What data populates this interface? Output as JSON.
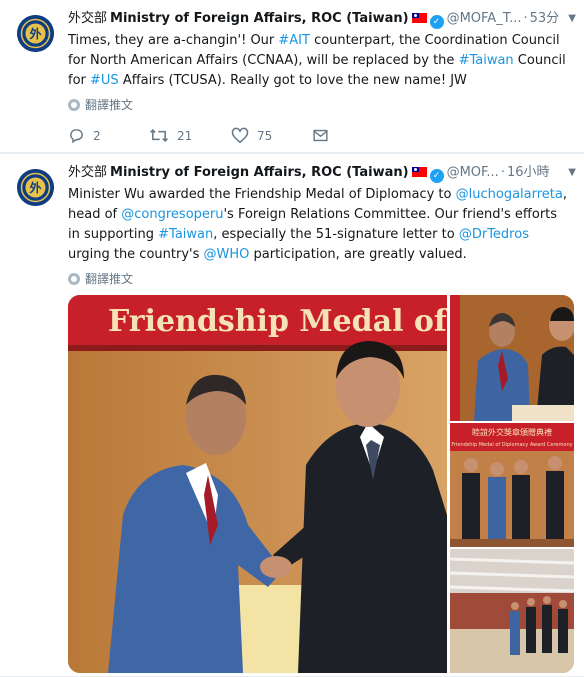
{
  "tweets": [
    {
      "account": {
        "name_zh": "外交部",
        "name_en": "Ministry of Foreign Affairs, ROC (Taiwan)",
        "handle": "@MOFA_T...",
        "time": "53分"
      },
      "text_segments": [
        {
          "t": "Times, they are a-changin'! Our ",
          "link": false
        },
        {
          "t": "#AIT",
          "link": true
        },
        {
          "t": " counterpart, the Coordination Council for North American Affairs (CCNAA), will be replaced by the ",
          "link": false
        },
        {
          "t": "#Taiwan",
          "link": true
        },
        {
          "t": " Council for ",
          "link": false
        },
        {
          "t": "#US",
          "link": true
        },
        {
          "t": " Affairs (TCUSA). Really got to love the new name! JW",
          "link": false
        }
      ],
      "translate_label": "翻譯推文",
      "actions": {
        "replies": "2",
        "retweets": "21",
        "likes": "75"
      }
    },
    {
      "account": {
        "name_zh": "外交部",
        "name_en": "Ministry of Foreign Affairs, ROC (Taiwan)",
        "handle": "@MOF...",
        "time": "16小時"
      },
      "translate_label": "翻譯推文",
      "media": {
        "main_banner_text": "Friendship Medal of",
        "side_banner_zh": "睦誼外交獎章頒贈典禮",
        "side_banner_en": "Friendship Medal of Diplomacy Award Ceremony"
      }
    }
  ],
  "colors": {
    "link": "#1b95e0",
    "secondary": "#657786",
    "verified": "#1da1f2",
    "avatar_bg": "#0f3d82"
  },
  "icons": [
    "reply-icon",
    "retweet-icon",
    "like-icon",
    "message-icon",
    "globe-icon",
    "verified-badge-icon",
    "chevron-down-icon",
    "roc-flag-icon"
  ]
}
